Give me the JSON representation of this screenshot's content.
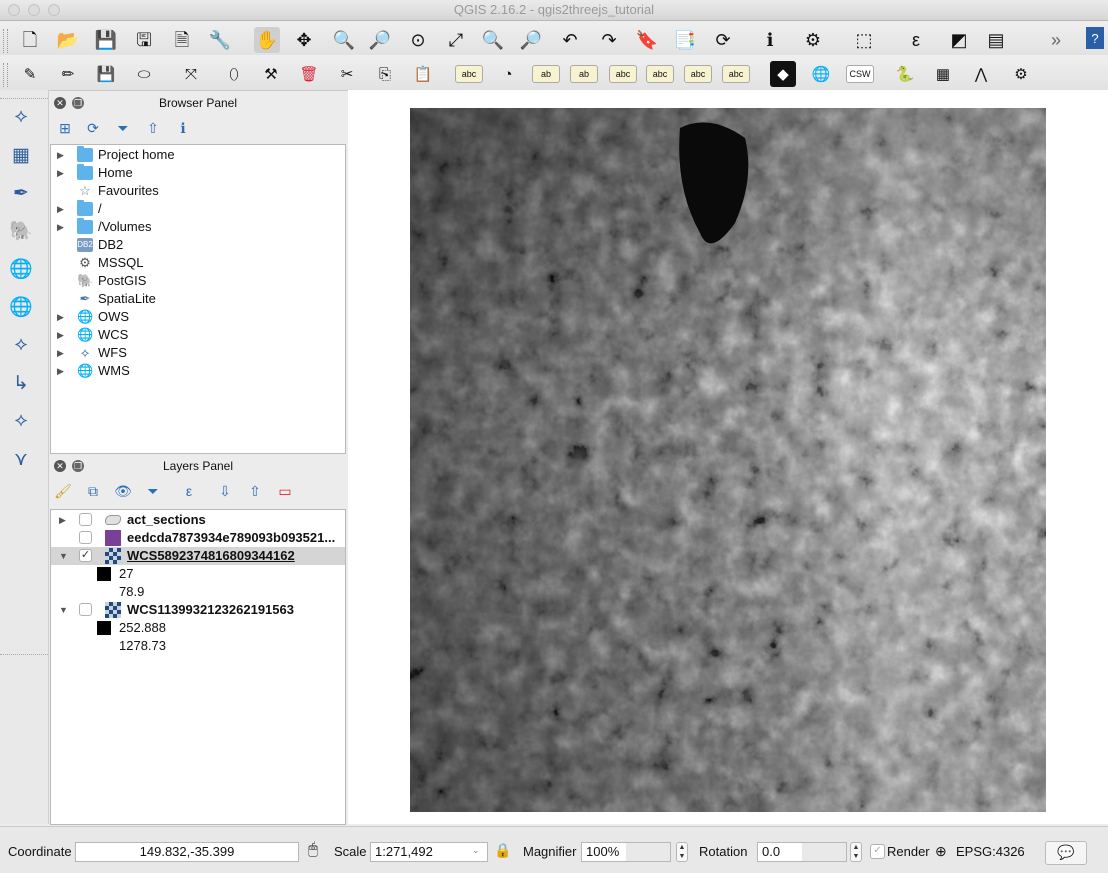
{
  "window": {
    "title": "QGIS 2.16.2 - qgis2threejs_tutorial"
  },
  "toolbar_row1": [
    {
      "name": "new-project-icon",
      "glyph": "🗋"
    },
    {
      "name": "open-project-icon",
      "glyph": "📂"
    },
    {
      "name": "save-project-icon",
      "glyph": "💾"
    },
    {
      "name": "save-as-icon",
      "glyph": "🖫"
    },
    {
      "name": "new-print-composer-icon",
      "glyph": "🗎"
    },
    {
      "name": "composer-manager-icon",
      "glyph": "🔧"
    },
    {
      "name": "pan-map-icon",
      "glyph": "✋"
    },
    {
      "name": "pan-to-selection-icon",
      "glyph": "✥"
    },
    {
      "name": "zoom-in-icon",
      "glyph": "🔍"
    },
    {
      "name": "zoom-out-icon",
      "glyph": "🔎"
    },
    {
      "name": "zoom-native-icon",
      "glyph": "⊙"
    },
    {
      "name": "zoom-full-icon",
      "glyph": "⤢"
    },
    {
      "name": "zoom-to-selection-icon",
      "glyph": "🔍"
    },
    {
      "name": "zoom-to-layer-icon",
      "glyph": "🔎"
    },
    {
      "name": "zoom-last-icon",
      "glyph": "↶"
    },
    {
      "name": "zoom-next-icon",
      "glyph": "↷"
    },
    {
      "name": "new-bookmark-icon",
      "glyph": "🔖"
    },
    {
      "name": "show-bookmarks-icon",
      "glyph": "📑"
    },
    {
      "name": "refresh-icon",
      "glyph": "⟳"
    },
    {
      "name": "identify-features-icon",
      "glyph": "ℹ"
    },
    {
      "name": "action-icon",
      "glyph": "⚙"
    },
    {
      "name": "select-features-icon",
      "glyph": "⬚"
    },
    {
      "name": "expression-select-icon",
      "glyph": "ε"
    },
    {
      "name": "deselect-icon",
      "glyph": "◩"
    },
    {
      "name": "open-attribute-table-icon",
      "glyph": "▤"
    },
    {
      "name": "toolbar-overflow-icon",
      "glyph": "»"
    },
    {
      "name": "whats-this-icon",
      "glyph": "?"
    }
  ],
  "toolbar_row2": [
    {
      "name": "current-edits-icon",
      "glyph": "✎"
    },
    {
      "name": "toggle-editing-icon",
      "glyph": "✏"
    },
    {
      "name": "save-edits-icon",
      "glyph": "💾"
    },
    {
      "name": "add-feature-icon",
      "glyph": "⬭"
    },
    {
      "name": "move-feature-icon",
      "glyph": "⤧"
    },
    {
      "name": "node-tool-icon",
      "glyph": "⬯"
    },
    {
      "name": "node-tool-2-icon",
      "glyph": "⚒"
    },
    {
      "name": "delete-selected-icon",
      "glyph": "🗑"
    },
    {
      "name": "cut-features-icon",
      "glyph": "✂"
    },
    {
      "name": "copy-features-icon",
      "glyph": "⎘"
    },
    {
      "name": "paste-features-icon",
      "glyph": "📋"
    },
    {
      "name": "label-tool-icon",
      "glyph": "abc"
    },
    {
      "name": "diagram-tool-icon",
      "glyph": "◔"
    },
    {
      "name": "highlight-label-icon",
      "glyph": "ab"
    },
    {
      "name": "pin-labels-icon",
      "glyph": "ab"
    },
    {
      "name": "show-hide-labels-icon",
      "glyph": "abc"
    },
    {
      "name": "move-label-icon",
      "glyph": "abc"
    },
    {
      "name": "rotate-label-icon",
      "glyph": "abc"
    },
    {
      "name": "change-label-icon",
      "glyph": "abc"
    },
    {
      "name": "qgis2threejs-icon",
      "glyph": "◆"
    },
    {
      "name": "metasearch-icon",
      "glyph": "🌐"
    },
    {
      "name": "csw-icon",
      "glyph": "CSW"
    },
    {
      "name": "python-console-icon",
      "glyph": "🐍"
    },
    {
      "name": "grid-plugin-icon",
      "glyph": "▦"
    },
    {
      "name": "network-plugin-icon",
      "glyph": "⋀"
    },
    {
      "name": "web-plugin-icon",
      "glyph": "⚙"
    }
  ],
  "left_toolbar": [
    {
      "name": "add-vector-layer-icon",
      "glyph": "⟡"
    },
    {
      "name": "add-raster-layer-icon",
      "glyph": "▦"
    },
    {
      "name": "add-spatialite-layer-icon",
      "glyph": "✒"
    },
    {
      "name": "add-postgis-layer-icon",
      "glyph": "🐘"
    },
    {
      "name": "add-wms-layer-icon",
      "glyph": "🌐"
    },
    {
      "name": "add-wcs-layer-icon",
      "glyph": "🌐"
    },
    {
      "name": "add-wfs-layer-icon",
      "glyph": "⟡"
    },
    {
      "name": "new-shapefile-icon",
      "glyph": "↳"
    },
    {
      "name": "add-delimited-text-icon",
      "glyph": "⟡"
    },
    {
      "name": "add-virtual-layer-icon",
      "glyph": "⋎"
    }
  ],
  "browser": {
    "title": "Browser Panel",
    "tools": [
      {
        "name": "add-selected-layers-icon",
        "glyph": "⊞"
      },
      {
        "name": "refresh-browser-icon",
        "glyph": "⟳"
      },
      {
        "name": "filter-browser-icon",
        "glyph": "⏷"
      },
      {
        "name": "collapse-all-icon",
        "glyph": "⇧"
      },
      {
        "name": "properties-icon",
        "glyph": "ℹ"
      }
    ],
    "items": [
      {
        "label": "Project home",
        "expand": true,
        "icon": "folder"
      },
      {
        "label": "Home",
        "expand": true,
        "icon": "folder"
      },
      {
        "label": "Favourites",
        "expand": false,
        "icon": "star"
      },
      {
        "label": "/",
        "expand": true,
        "icon": "folder"
      },
      {
        "label": "/Volumes",
        "expand": true,
        "icon": "folder"
      },
      {
        "label": "DB2",
        "expand": false,
        "icon": "db2"
      },
      {
        "label": "MSSQL",
        "expand": false,
        "icon": "mssql"
      },
      {
        "label": "PostGIS",
        "expand": false,
        "icon": "postgis"
      },
      {
        "label": "SpatiaLite",
        "expand": false,
        "icon": "spatialite"
      },
      {
        "label": "OWS",
        "expand": true,
        "icon": "globe"
      },
      {
        "label": "WCS",
        "expand": true,
        "icon": "globe"
      },
      {
        "label": "WFS",
        "expand": true,
        "icon": "wfs"
      },
      {
        "label": "WMS",
        "expand": true,
        "icon": "globe"
      }
    ]
  },
  "layers": {
    "title": "Layers Panel",
    "tools": [
      {
        "name": "layer-styling-icon",
        "glyph": "🖌"
      },
      {
        "name": "add-group-icon",
        "glyph": "⧉"
      },
      {
        "name": "manage-visibility-icon",
        "glyph": "👁"
      },
      {
        "name": "filter-legend-icon",
        "glyph": "⏷"
      },
      {
        "name": "filter-expression-icon",
        "glyph": "ε"
      },
      {
        "name": "expand-all-icon",
        "glyph": "⇩"
      },
      {
        "name": "collapse-all-layers-icon",
        "glyph": "⇧"
      },
      {
        "name": "remove-layer-icon",
        "glyph": "▭"
      }
    ],
    "items": [
      {
        "label": "act_sections",
        "checked": false,
        "arrow": "▶",
        "icon": "polygon",
        "bold": true,
        "selected": false
      },
      {
        "label": "eedcda7873934e789093b093521...",
        "checked": false,
        "arrow": "",
        "icon": "purple",
        "bold": true,
        "selected": false
      },
      {
        "label": "WCS5892374816809344162",
        "checked": true,
        "arrow": "▼",
        "icon": "raster",
        "bold": true,
        "selected": true,
        "legend": [
          "27",
          "78.9"
        ]
      },
      {
        "label": "WCS1139932123262191563",
        "checked": false,
        "arrow": "▼",
        "icon": "raster",
        "bold": true,
        "selected": false,
        "legend": [
          "252.888",
          "1278.73"
        ]
      }
    ]
  },
  "statusbar": {
    "coordinate_label": "Coordinate",
    "coordinate_value": "149.832,-35.399",
    "scale_label": "Scale",
    "scale_value": "1:271,492",
    "magnifier_label": "Magnifier",
    "magnifier_value": "100%",
    "rotation_label": "Rotation",
    "rotation_value": "0.0",
    "render_label": "Render",
    "crs_value": "EPSG:4326"
  },
  "colors": {
    "accent": "#2f7bd6",
    "selected_row": "#d5d5d5",
    "purple_layer": "#7a3f98"
  }
}
